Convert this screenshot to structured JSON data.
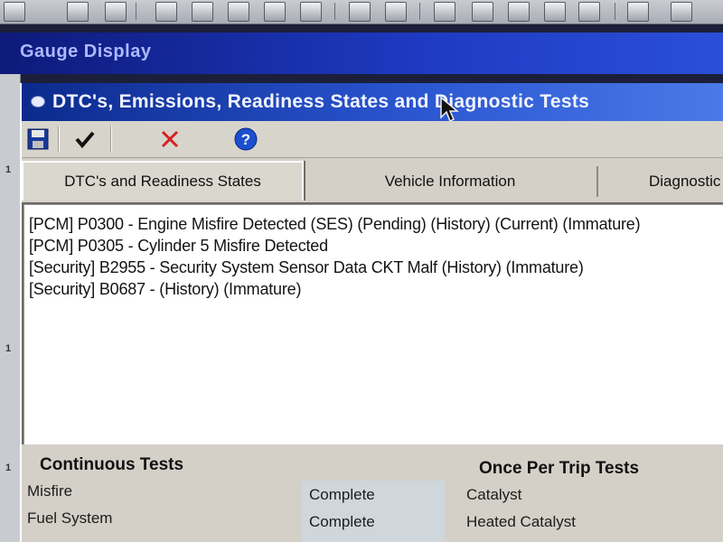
{
  "window": {
    "outer_title": "Gauge Display",
    "dialog_title": "DTC's, Emissions, Readiness States and Diagnostic Tests"
  },
  "app_toolbar": {
    "icons": [
      "toolbar-icon",
      "toolbar-icon",
      "toolbar-icon",
      "toolbar-icon",
      "toolbar-icon",
      "toolbar-icon",
      "toolbar-icon",
      "toolbar-icon",
      "toolbar-icon",
      "toolbar-icon",
      "toolbar-icon",
      "toolbar-icon",
      "toolbar-icon",
      "toolbar-icon",
      "toolbar-icon",
      "toolbar-icon"
    ]
  },
  "dialog_toolbar": {
    "buttons": [
      "save-icon",
      "check-icon",
      "close-icon",
      "help-icon"
    ]
  },
  "tabs": [
    {
      "label": "DTC's and Readiness States",
      "active": true
    },
    {
      "label": "Vehicle Information",
      "active": false
    },
    {
      "label": "Diagnostic",
      "active": false
    }
  ],
  "dtc_list": [
    "[PCM] P0300 - Engine Misfire Detected (SES) (Pending) (History) (Current) (Immature)",
    "[PCM] P0305 - Cylinder 5 Misfire Detected",
    "[Security] B2955 - Security System Sensor Data CKT Malf (History) (Immature)",
    "[Security] B0687 -  (History) (Immature)"
  ],
  "tests": {
    "continuous_header": "Continuous Tests",
    "once_per_trip_header": "Once Per Trip Tests",
    "continuous": [
      {
        "name": "Misfire",
        "status": "Complete"
      },
      {
        "name": "Fuel System",
        "status": "Complete"
      }
    ],
    "once_per_trip": [
      {
        "name": "Catalyst"
      },
      {
        "name": "Heated Catalyst"
      }
    ]
  },
  "left_rail_marks": [
    "1",
    "1",
    "1"
  ],
  "colors": {
    "title_bar": "#1f3bc4",
    "close_red": "#d42020",
    "help_blue": "#1b4fd0"
  }
}
